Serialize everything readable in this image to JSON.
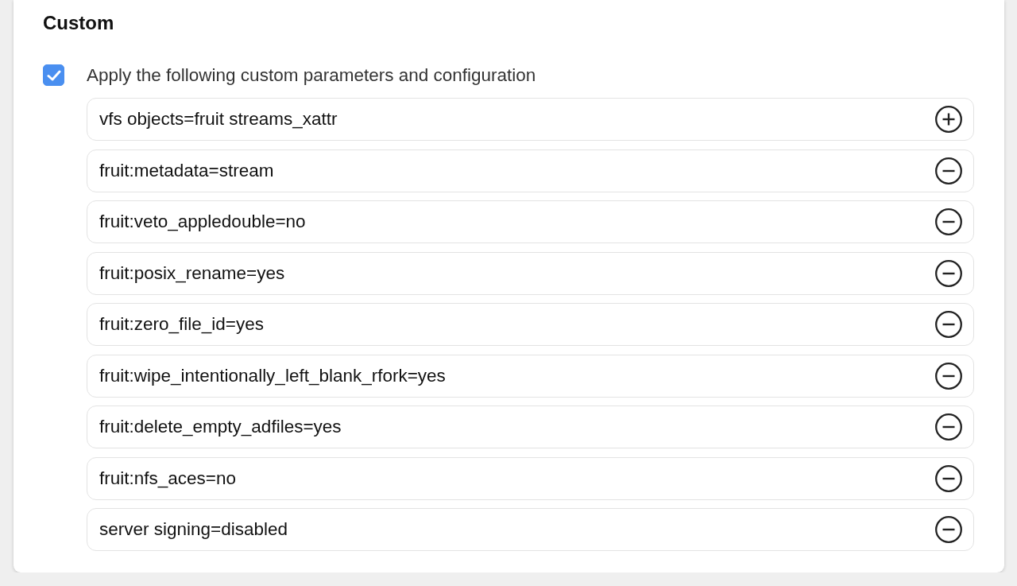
{
  "section": {
    "title": "Custom",
    "apply_checkbox": {
      "label": "Apply the following custom parameters and configuration",
      "checked": true
    },
    "parameters": [
      {
        "value": "vfs objects=fruit streams_xattr",
        "kind": "add"
      },
      {
        "value": "fruit:metadata=stream",
        "kind": "remove"
      },
      {
        "value": "fruit:veto_appledouble=no",
        "kind": "remove"
      },
      {
        "value": "fruit:posix_rename=yes",
        "kind": "remove"
      },
      {
        "value": "fruit:zero_file_id=yes",
        "kind": "remove"
      },
      {
        "value": "fruit:wipe_intentionally_left_blank_rfork=yes",
        "kind": "remove"
      },
      {
        "value": "fruit:delete_empty_adfiles=yes",
        "kind": "remove"
      },
      {
        "value": "fruit:nfs_aces=no",
        "kind": "remove"
      },
      {
        "value": "server signing=disabled",
        "kind": "remove"
      }
    ]
  }
}
